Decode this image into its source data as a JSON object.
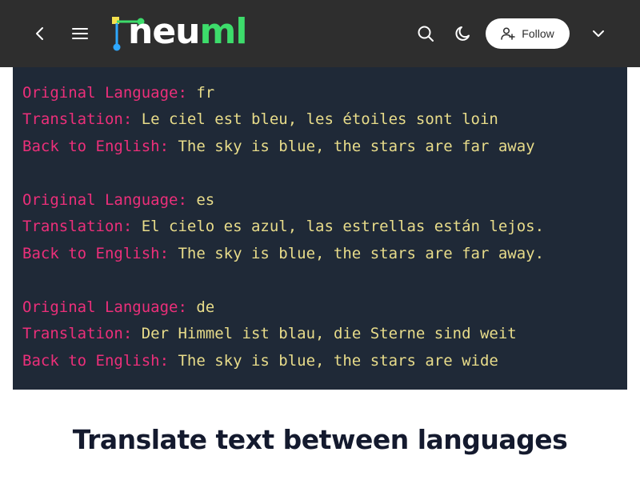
{
  "header": {
    "logo_text_main": "neu",
    "logo_text_accent": "ml",
    "follow_label": "Follow",
    "icons": [
      "back-icon",
      "menu-icon",
      "search-icon",
      "moon-icon",
      "add-user-icon",
      "chevron-down-icon"
    ]
  },
  "code": {
    "blocks": [
      {
        "original_key": "Original Language:",
        "original_val": " fr",
        "translation_key": "Translation:",
        "translation_val": " Le ciel est bleu, les étoiles sont loin",
        "back_key": "Back to English:",
        "back_val": " The sky is blue, the stars are far away"
      },
      {
        "original_key": "Original Language:",
        "original_val": " es",
        "translation_key": "Translation:",
        "translation_val": " El cielo es azul, las estrellas están lejos.",
        "back_key": "Back to English:",
        "back_val": " The sky is blue, the stars are far away."
      },
      {
        "original_key": "Original Language:",
        "original_val": " de",
        "translation_key": "Translation:",
        "translation_val": " Der Himmel ist blau, die Sterne sind weit",
        "back_key": "Back to English:",
        "back_val": " The sky is blue, the stars are wide"
      }
    ]
  },
  "article": {
    "heading": "Translate text between languages"
  },
  "colors": {
    "topbar": "#2e2e2e",
    "code_bg": "#1f2937",
    "code_key": "#ec2f7a",
    "code_value": "#e8dc8a",
    "logo_accent": "#3ddc6b",
    "heading": "#141a2e"
  }
}
